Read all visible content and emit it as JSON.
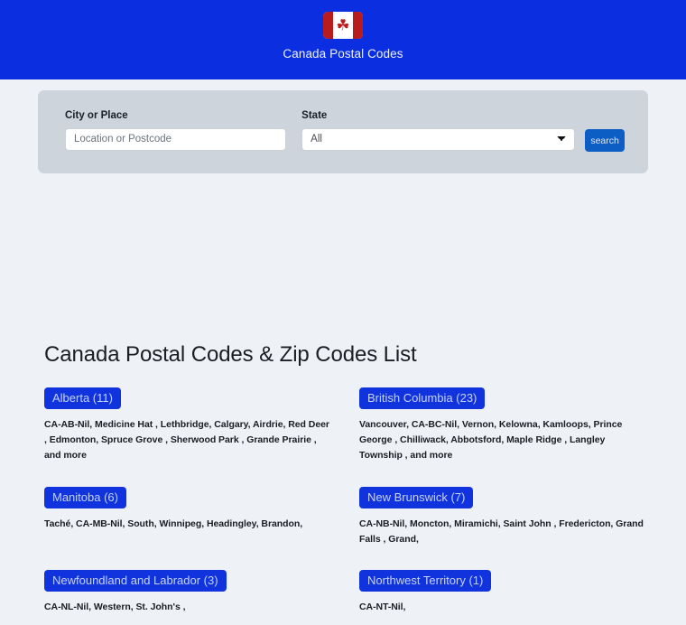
{
  "header": {
    "title": "Canada Postal Codes",
    "flag_icon": "canada-flag-icon",
    "leaf_glyph": "☘",
    "background_color": "#0A2EE0"
  },
  "search": {
    "city_label": "City or Place",
    "city_placeholder": "Location or Postcode",
    "city_value": "",
    "state_label": "State",
    "state_selected": "All",
    "state_options": [
      "All"
    ],
    "button_label": "search",
    "button_color": "#0d5ec4",
    "panel_color": "#ced4db"
  },
  "listing": {
    "title": "Canada Postal Codes & Zip Codes List",
    "badge_color": "#1033dd",
    "provinces": [
      {
        "name": "Alberta",
        "count": "11",
        "badge": "Alberta (11)",
        "cities": "CA-AB-Nil, Medicine Hat , Lethbridge, Calgary, Airdrie, Red Deer , Edmonton, Spruce Grove , Sherwood Park , Grande Prairie , and more"
      },
      {
        "name": "British Columbia",
        "count": "23",
        "badge": "British Columbia (23)",
        "cities": "Vancouver, CA-BC-Nil, Vernon, Kelowna, Kamloops, Prince George , Chilliwack, Abbotsford, Maple Ridge , Langley Township , and more"
      },
      {
        "name": "Manitoba",
        "count": "6",
        "badge": "Manitoba (6)",
        "cities": "Taché, CA-MB-Nil, South, Winnipeg, Headingley, Brandon,"
      },
      {
        "name": "New Brunswick",
        "count": "7",
        "badge": "New Brunswick (7)",
        "cities": "CA-NB-Nil, Moncton, Miramichi, Saint John , Fredericton, Grand Falls , Grand,"
      },
      {
        "name": "Newfoundland and Labrador",
        "count": "3",
        "badge": "Newfoundland and Labrador (3)",
        "cities": "CA-NL-Nil, Western, St. John's ,"
      },
      {
        "name": "Northwest Territory",
        "count": "1",
        "badge": "Northwest Territory (1)",
        "cities": "CA-NT-Nil,"
      }
    ]
  }
}
